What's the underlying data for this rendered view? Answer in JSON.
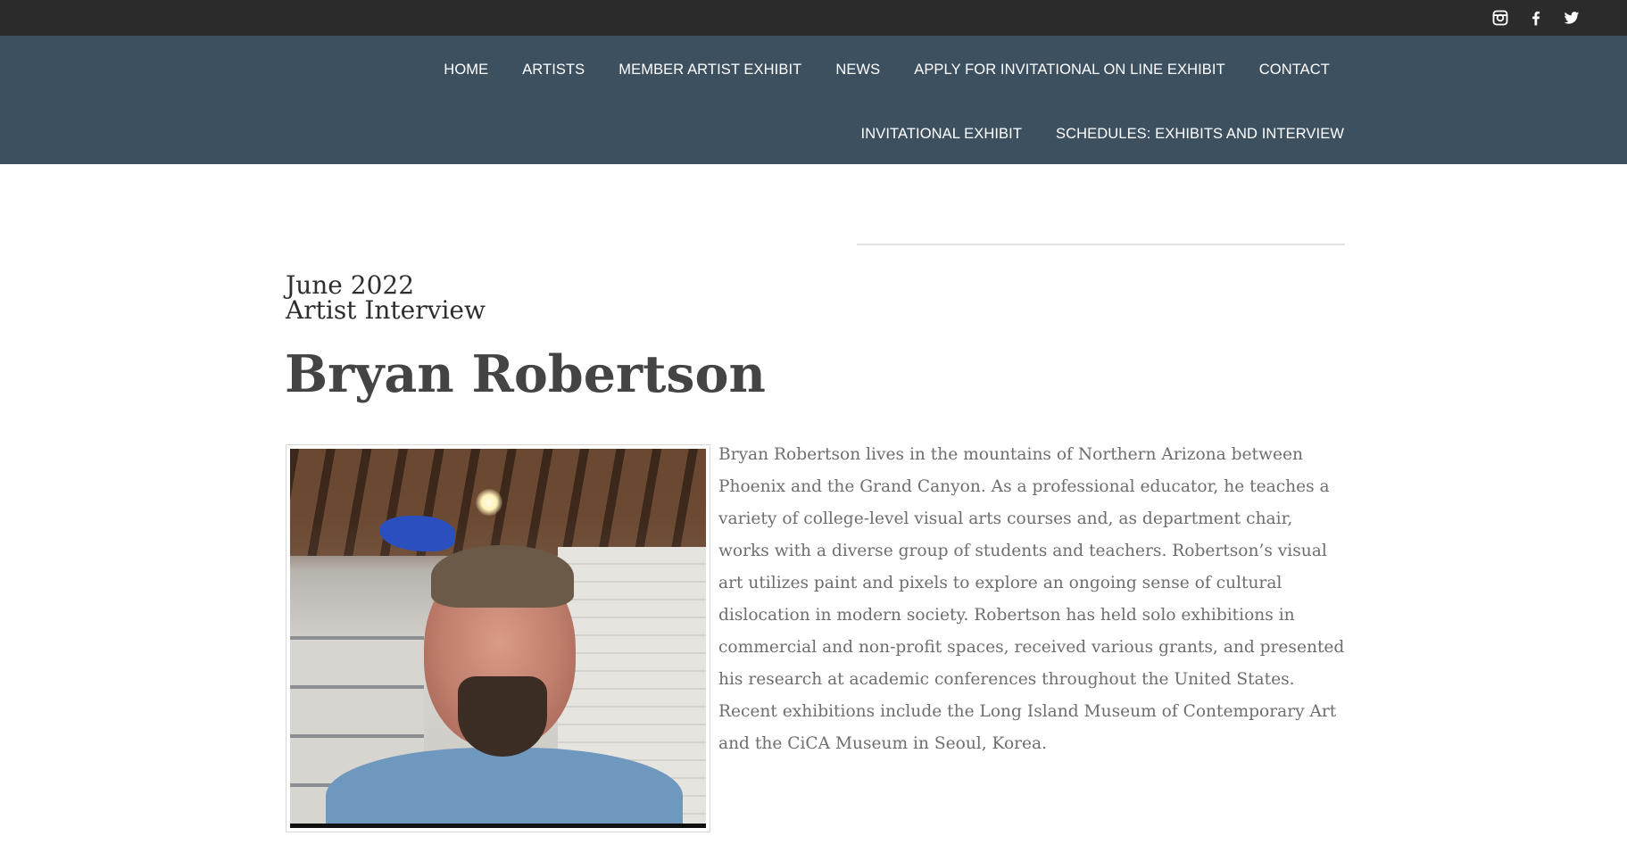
{
  "social": {
    "icons": [
      "instagram-icon",
      "facebook-icon",
      "twitter-icon"
    ]
  },
  "nav": {
    "row1": [
      "HOME",
      "ARTISTS",
      "MEMBER ARTIST EXHIBIT",
      "NEWS",
      "APPLY FOR INVITATIONAL ON LINE EXHIBIT",
      "CONTACT"
    ],
    "row2": [
      "INVITATIONAL EXHIBIT",
      "SCHEDULES: EXHIBITS AND INTERVIEW"
    ]
  },
  "article": {
    "date": "June 2022",
    "type": "Artist Interview",
    "name": "Bryan Robertson",
    "bio": " Bryan Robertson lives in the mountains of Northern Arizona between Phoenix and the Grand Canyon. As a professional educator, he teaches a variety of college-level visual arts courses and, as department chair, works with a diverse group of students and teachers. Robertson’s visual art utilizes paint and pixels to explore an ongoing sense of cultural dislocation in modern society. Robertson has held solo exhibitions in commercial and non-profit spaces, received various grants, and presented his research at academic conferences throughout the United States. Recent exhibitions include the Long Island Museum of Contemporary Art and the CiCA Museum in Seoul, Korea."
  },
  "colors": {
    "topbar": "#2b2b2b",
    "navbar": "#3d5060",
    "heading": "#444444",
    "body_text": "#6e6e6e"
  }
}
